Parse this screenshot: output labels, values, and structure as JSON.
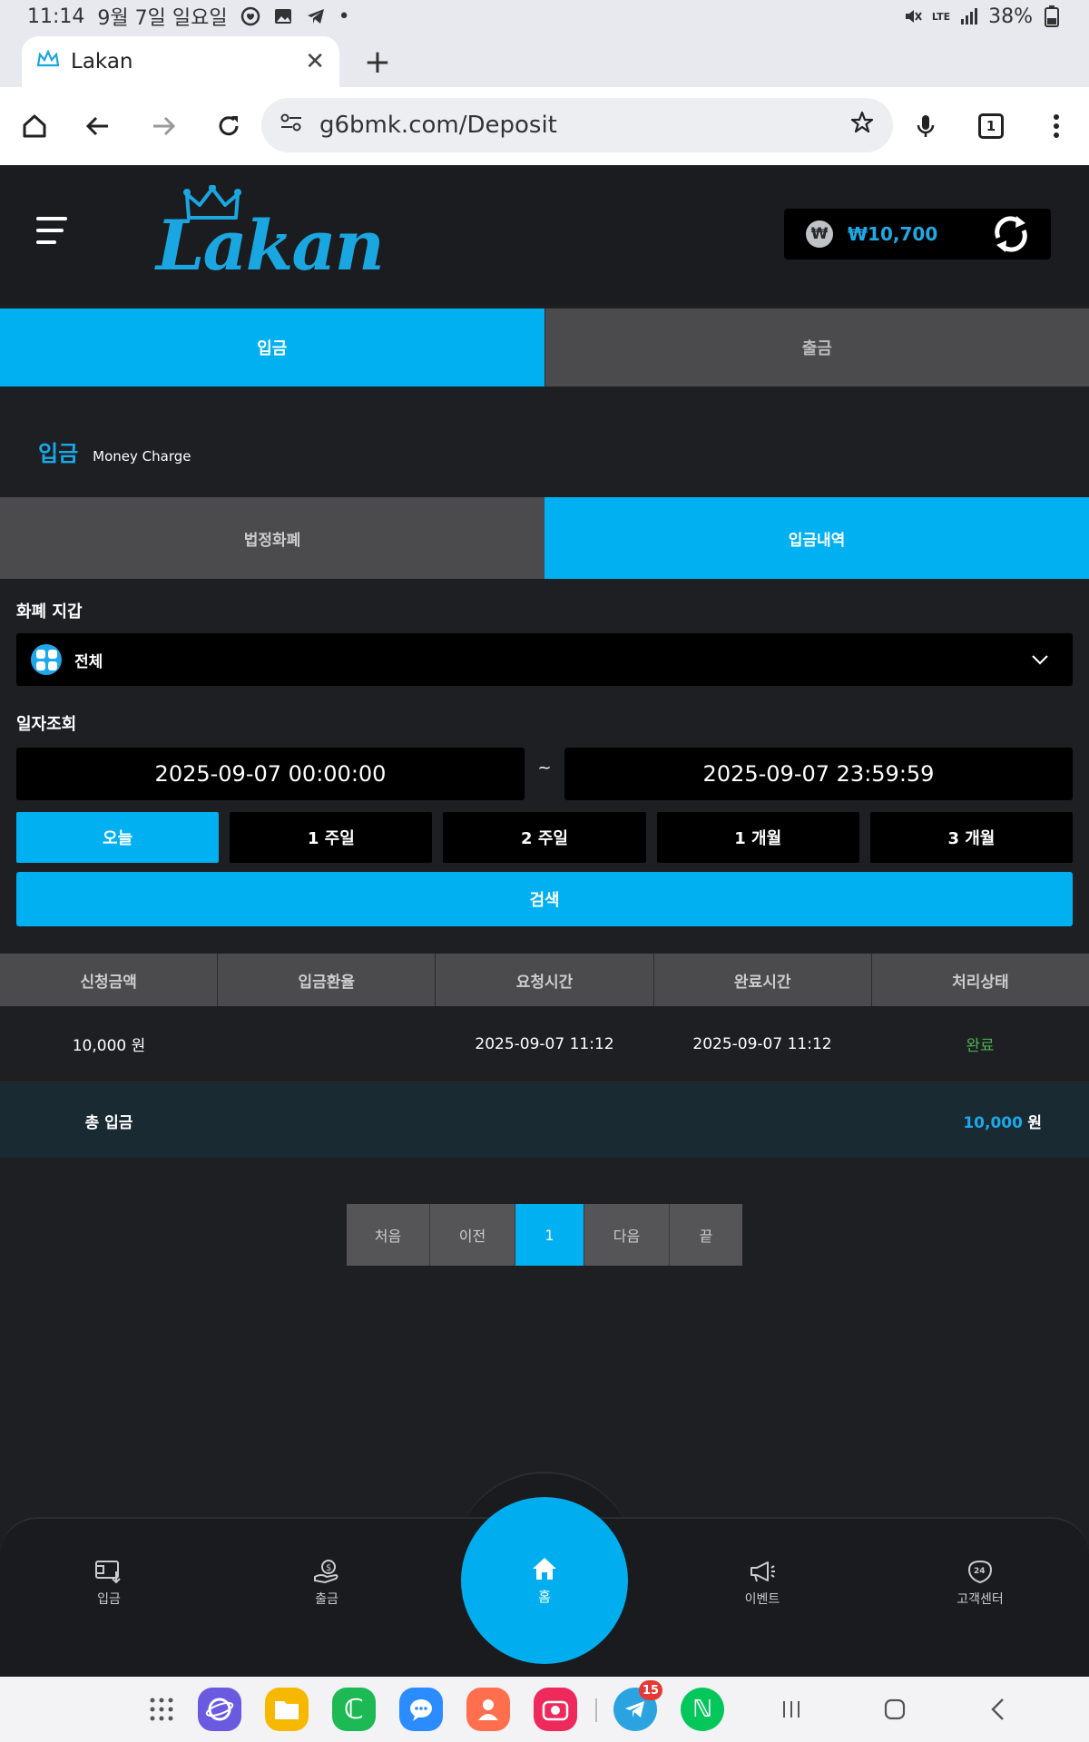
{
  "status_bar": {
    "time": "11:14",
    "date": "9월 7일 일요일",
    "network": "LTE",
    "battery": "38%"
  },
  "browser": {
    "tab_title": "Lakan",
    "url": "g6bmk.com/Deposit",
    "tab_count": "1"
  },
  "header": {
    "logo": "Lakan",
    "currency_symbol": "₩",
    "balance": "₩10,700"
  },
  "main_tabs": [
    {
      "label": "입금",
      "active": true
    },
    {
      "label": "출금",
      "active": false
    }
  ],
  "section": {
    "title": "입금",
    "subtitle": "Money Charge"
  },
  "sub_tabs": [
    {
      "label": "법정화폐",
      "active": false
    },
    {
      "label": "입금내역",
      "active": true
    }
  ],
  "filters": {
    "wallet_label": "화폐 지갑",
    "wallet_value": "전체",
    "date_label": "일자조회",
    "date_from": "2025-09-07 00:00:00",
    "date_separator": "~",
    "date_to": "2025-09-07 23:59:59",
    "periods": [
      "오늘",
      "1 주일",
      "2 주일",
      "1 개월",
      "3 개월"
    ],
    "active_period": "오늘",
    "search_label": "검색"
  },
  "table": {
    "columns": [
      "신청금액",
      "입금환율",
      "요청시간",
      "완료시간",
      "처리상태"
    ],
    "rows": [
      {
        "amount": "10,000 원",
        "rate": "",
        "requested": "2025-09-07 11:12",
        "completed": "2025-09-07 11:12",
        "status": "완료"
      }
    ],
    "total_label": "총 입금",
    "total_value": "10,000",
    "total_unit": "원"
  },
  "pagination": {
    "first": "처음",
    "prev": "이전",
    "current": "1",
    "next": "다음",
    "last": "끝"
  },
  "bottom_nav": {
    "deposit": "입금",
    "withdraw": "출금",
    "home": "홈",
    "event": "이벤트",
    "support": "고객센터"
  },
  "android_dock": {
    "telegram_badge": "15"
  },
  "colors": {
    "accent": "#00b0f0",
    "header_bg": "#1b1c1f",
    "page_bg": "#1d1f22",
    "inactive_tab": "#4b4b4d",
    "status_done": "#4caf50"
  }
}
